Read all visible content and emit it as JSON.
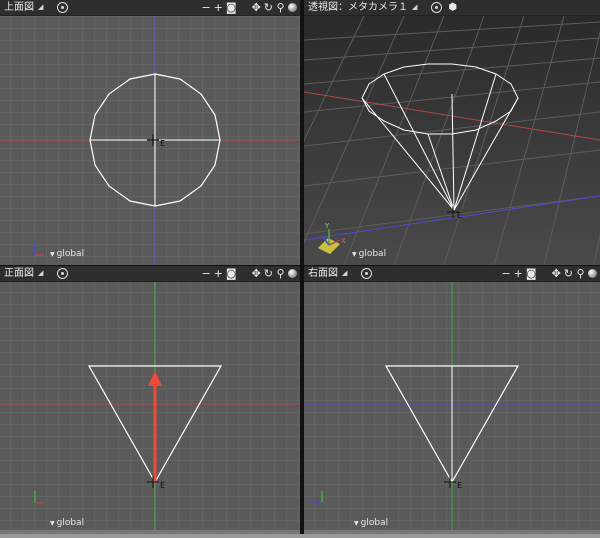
{
  "viewports": {
    "top": {
      "title": "上面図",
      "coord_system": "global"
    },
    "persp": {
      "title": "透視図：メタカメラ１",
      "coord_system": "global"
    },
    "front": {
      "title": "正面図",
      "coord_system": "global"
    },
    "right": {
      "title": "右面図",
      "coord_system": "global"
    }
  },
  "toolbar_icons": [
    "display-mode-icon",
    "zoom-out-icon",
    "zoom-in-icon",
    "camera-icon",
    "pan-icon",
    "rotate-icon",
    "magnify-icon",
    "shading-ball-icon"
  ],
  "colors": {
    "viewport_bg": "#5a5a5a",
    "grid": "#6b6b6b",
    "axis_x": "#b04848",
    "axis_y": "#3fae3f",
    "axis_z": "#4b4bd0",
    "wire": "#ffffff",
    "manipulator_arrow": "#f04a3a"
  }
}
